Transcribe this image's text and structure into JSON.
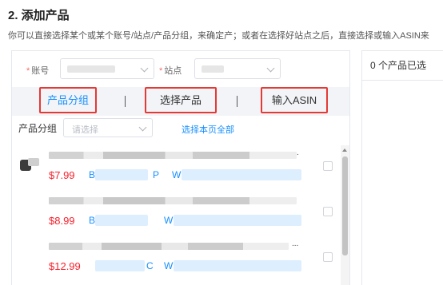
{
  "section": {
    "title": "2. 添加产品",
    "description": "你可以直接选择某个或某个账号/站点/产品分组，来确定产；或者在选择好站点之后，直接选择或输入ASIN来"
  },
  "filters": {
    "account_label": "账号",
    "site_label": "站点",
    "required_mark": "*"
  },
  "tabs": [
    {
      "label": "产品分组",
      "active": true
    },
    {
      "label": "选择产品",
      "active": false
    },
    {
      "label": "输入ASIN",
      "active": false
    }
  ],
  "group": {
    "label": "产品分组",
    "placeholder": "请选择",
    "select_all": "选择本页全部"
  },
  "products": [
    {
      "price": "$7.99",
      "asin_letter": "B",
      "code_letter": "P",
      "sku_letter": "W"
    },
    {
      "price": "$8.99",
      "asin_letter": "B",
      "code_letter": "",
      "sku_letter": "W"
    },
    {
      "price": "$12.99",
      "asin_letter": "",
      "code_letter": "C",
      "sku_letter": "W"
    }
  ],
  "selected_panel": {
    "header": "0 个产品已选"
  },
  "colors": {
    "accent": "#1890ff",
    "price": "#f5222d",
    "highlight_box": "#e53935"
  }
}
